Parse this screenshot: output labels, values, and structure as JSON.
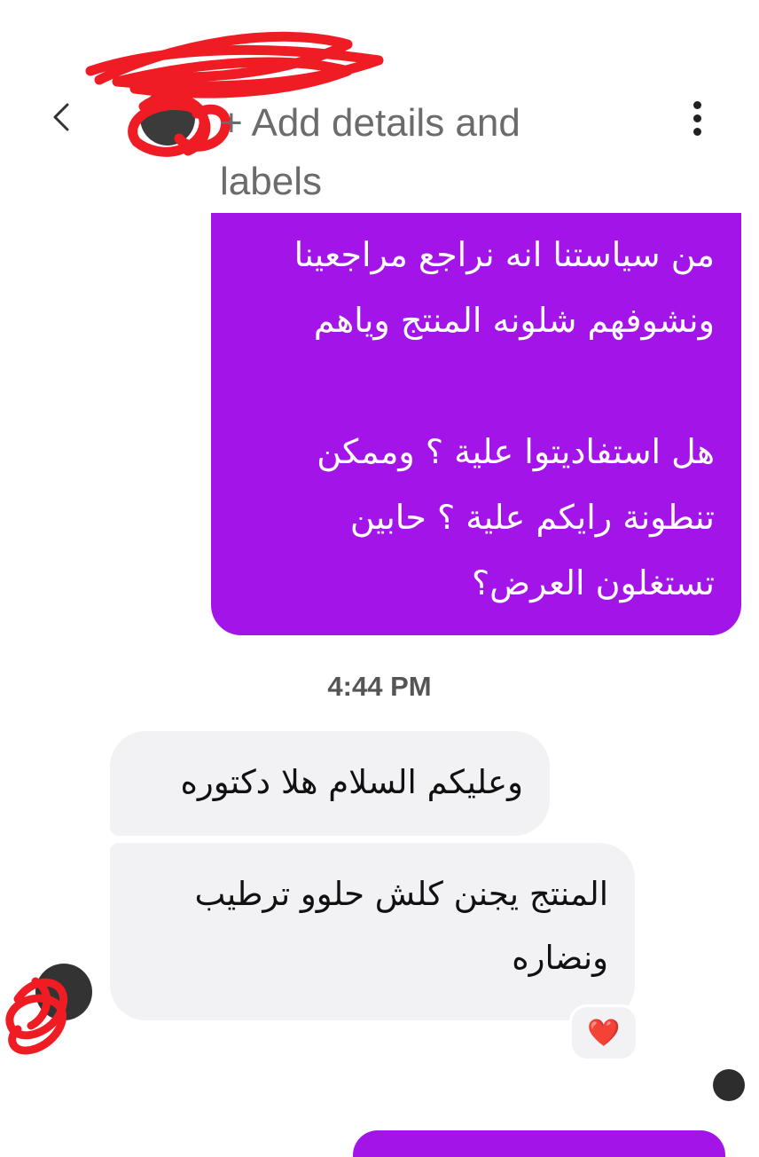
{
  "header": {
    "title": "+ Add details and labels",
    "back_icon": "chevron-left-icon",
    "more_icon": "more-vertical-icon"
  },
  "messages": {
    "outgoing_text": "من سياستنا انه نراجع مراجعينا\nونشوفهم شلونه المنتج وياهم\n\nهل استفاديتوا علية ؟ وممكن\nتنطونة رايكم علية ؟ حابين\nتستغلون العرض؟",
    "timestamp": "4:44 PM",
    "incoming": [
      {
        "text": "وعليكم السلام هلا دكتوره"
      },
      {
        "text": "المنتج يجنن كلش حلوو ترطيب ونضاره"
      }
    ],
    "reaction": "❤️"
  },
  "colors": {
    "outgoing_bubble": "#a314e8",
    "incoming_bubble": "#f2f2f5",
    "redaction_scribble": "#f01c24"
  }
}
